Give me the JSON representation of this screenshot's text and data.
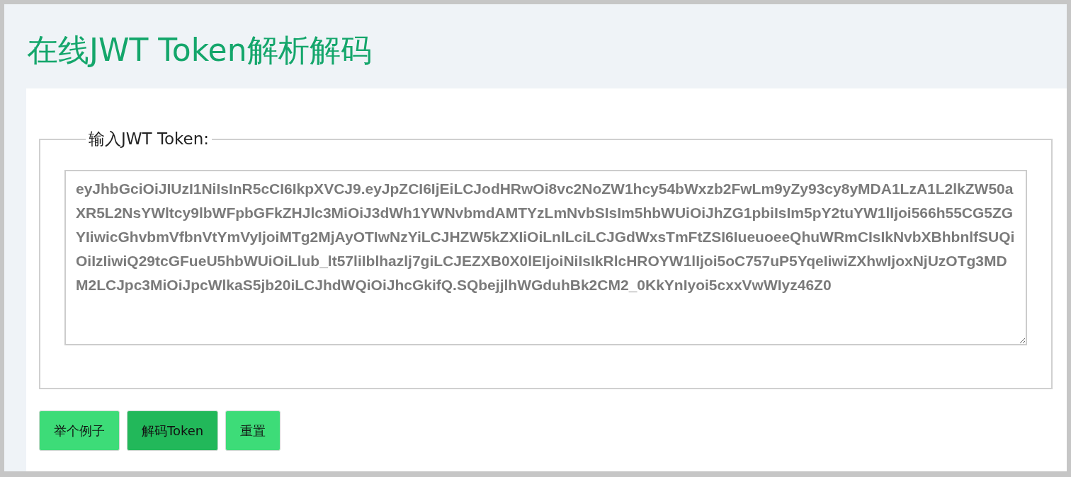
{
  "title": "在线JWT Token解析解码",
  "input": {
    "legend": "输入JWT Token:",
    "value": "eyJhbGciOiJIUzI1NiIsInR5cCI6IkpXVCJ9.eyJpZCI6IjEiLCJodHRwOi8vc2NoZW1hcy54bWxzb2FwLm9yZy93cy8yMDA1LzA1L2lkZW50aXR5L2NsYWltcy9lbWFpbGFkZHJlc3MiOiJ3dWh1YWNvbmdAMTYzLmNvbSIsIm5hbWUiOiJhZG1pbiIsIm5pY2tuYW1lIjoi566h55CG5ZGYIiwicGhvbmVfbnVtYmVyIjoiMTg2MjAyOTIwNzYiLCJHZW5kZXIiOiLnlLciLCJGdWxsTmFtZSI6IueuoeeQhuWRmCIsIkNvbXBhbnlfSUQiOiIzIiwiQ29tcGFueU5hbWUiOiLlub_lt57liIblhazlj7giLCJEZXB0X0lEIjoiNiIsIkRlcHROYW1lIjoi5oC757uP5YqeIiwiZXhwIjoxNjUzOTg3MDM2LCJpc3MiOiJpcWlkaS5jb20iLCJhdWQiOiJhcGkifQ.SQbejjlhWGduhBk2CM2_0KkYnIyoi5cxxVwWIyz46Z0"
  },
  "buttons": [
    {
      "label": "举个例子",
      "active": false
    },
    {
      "label": "解码Token",
      "active": true
    },
    {
      "label": "重置",
      "active": false
    }
  ]
}
